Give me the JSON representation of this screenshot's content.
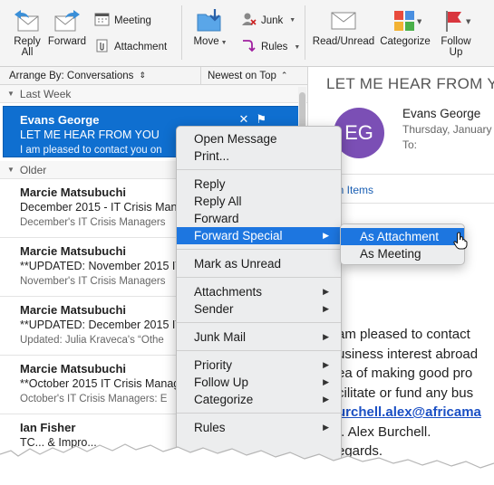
{
  "ribbon": {
    "reply_all": "Reply\nAll",
    "reply_all_l1": "Reply",
    "reply_all_l2": "All",
    "forward": "Forward",
    "meeting": "Meeting",
    "attachment": "Attachment",
    "move": "Move",
    "junk": "Junk",
    "rules": "Rules",
    "read_unread": "Read/Unread",
    "categorize": "Categorize",
    "follow_up_l1": "Follow",
    "follow_up_l2": "Up"
  },
  "list": {
    "arrange_by": "Arrange By: Conversations",
    "arrange_caret": "⌃⌄",
    "sort_order": "Newest on Top",
    "groups": [
      {
        "label": "Last Week"
      },
      {
        "label": "Older"
      }
    ],
    "selected": {
      "from": "Evans George",
      "subject": "LET ME HEAR FROM YOU",
      "preview": "I am pleased to contact you on"
    },
    "messages": [
      {
        "from": "Marcie Matsubuchi",
        "subject": "December 2015 - IT Crisis Mana",
        "preview": "December's IT Crisis Managers"
      },
      {
        "from": "Marcie Matsubuchi",
        "subject": "**UPDATED:  November 2015 IT",
        "preview": "November's IT Crisis Managers"
      },
      {
        "from": "Marcie Matsubuchi",
        "subject": "**UPDATED:  December 2015 IT C",
        "preview": "Updated: Julia Kraveca's “Othe"
      },
      {
        "from": "Marcie Matsubuchi",
        "subject": "**October 2015 IT Crisis Manag",
        "preview": "October's IT Crisis Managers: E"
      },
      {
        "from": "Ian Fisher",
        "subject": "TC... & Impro...",
        "preview": ""
      }
    ]
  },
  "reading": {
    "subject": "LET ME HEAR FROM YOU",
    "avatar_initials": "EG",
    "from": "Evans George",
    "date": "Thursday, January",
    "to_label": "To:",
    "related": "on Items",
    "body": [
      {
        "text": "am pleased to contact",
        "link": false
      },
      {
        "text": "usiness interest abroad",
        "link": false
      },
      {
        "text": "ea of making good pro",
        "link": false
      },
      {
        "text": "cilitate or fund any bus",
        "link": false
      },
      {
        "text": "urchell.alex@africama",
        "link": true
      },
      {
        "text": "r. Alex Burchell.",
        "link": false
      },
      {
        "text": "egards.",
        "link": false
      }
    ]
  },
  "context_menu": {
    "open_message": "Open Message",
    "print": "Print...",
    "reply": "Reply",
    "reply_all": "Reply All",
    "forward": "Forward",
    "forward_special": "Forward Special",
    "mark_unread": "Mark as Unread",
    "attachments": "Attachments",
    "sender": "Sender",
    "junk_mail": "Junk Mail",
    "priority": "Priority",
    "follow_up": "Follow Up",
    "categorize": "Categorize",
    "rules": "Rules"
  },
  "submenu": {
    "as_attachment": "As Attachment",
    "as_meeting": "As Meeting"
  },
  "colors": {
    "selection": "#0f6fd0",
    "menu_highlight": "#1d76e0",
    "avatar": "#7b4fb5",
    "link": "#1a4fc4"
  }
}
